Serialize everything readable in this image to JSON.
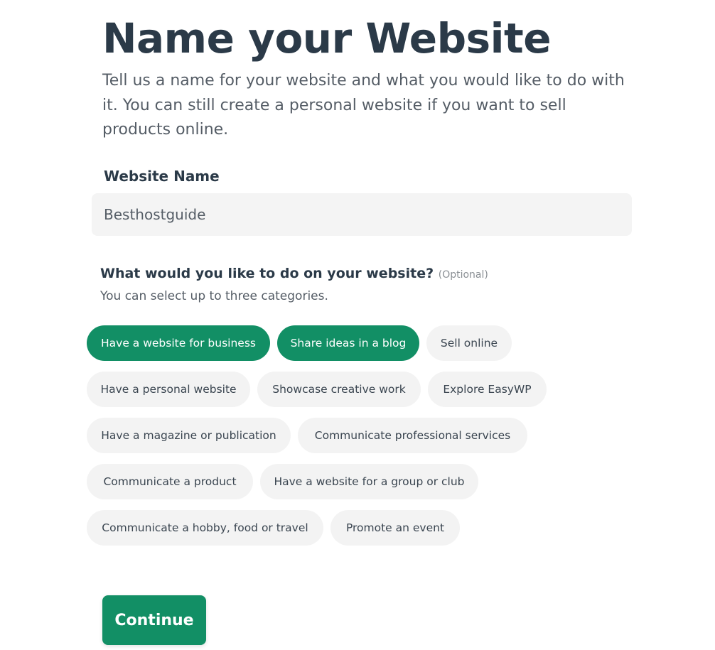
{
  "header": {
    "title": "Name your Website",
    "subtitle": "Tell us a name for your website and what you would like to do with it. You can still create a personal website if you want to sell products online."
  },
  "website_name": {
    "label": "Website Name",
    "value": "Besthostguide"
  },
  "categories": {
    "question": "What would you like to do on your website?",
    "optional": "(Optional)",
    "hint": "You can select up to three categories.",
    "options": [
      {
        "label": "Have a website for business",
        "selected": true
      },
      {
        "label": "Share ideas in a blog",
        "selected": true
      },
      {
        "label": "Sell online",
        "selected": false
      },
      {
        "label": "Have a personal website",
        "selected": false
      },
      {
        "label": "Showcase creative work",
        "selected": false
      },
      {
        "label": "Explore EasyWP",
        "selected": false
      },
      {
        "label": "Have a magazine or publication",
        "selected": false
      },
      {
        "label": "Communicate professional services",
        "selected": false
      },
      {
        "label": "Communicate a product",
        "selected": false
      },
      {
        "label": "Have a website for a group or club",
        "selected": false
      },
      {
        "label": "Communicate a hobby, food or travel",
        "selected": false
      },
      {
        "label": "Promote an event",
        "selected": false
      }
    ]
  },
  "continue_label": "Continue",
  "colors": {
    "accent": "#128f65",
    "heading": "#2b3a48",
    "chip_bg": "#f3f3f3"
  }
}
